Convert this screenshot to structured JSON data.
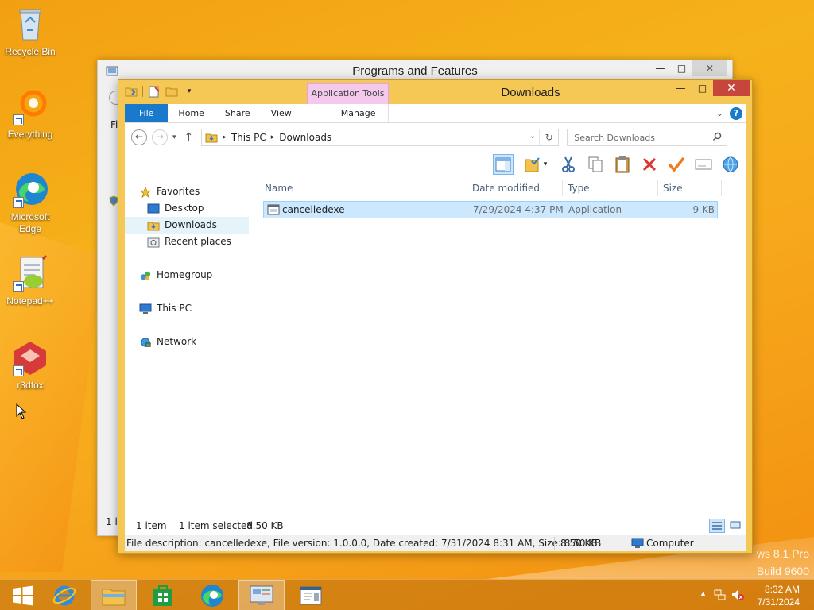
{
  "desktop": {
    "icons": [
      {
        "label": "Recycle Bin"
      },
      {
        "label": "Everything"
      },
      {
        "label": "Microsoft Edge"
      },
      {
        "label": "Notepad++"
      },
      {
        "label": "r3dfox"
      }
    ],
    "watermark_line1": "ws 8.1 Pro",
    "watermark_line2": "Build 9600"
  },
  "back_window": {
    "title": "Programs and Features",
    "partial_label1": "Fi",
    "partial_label2": "1 it",
    "minimize": "—",
    "maximize": "□",
    "close": "✕"
  },
  "explorer": {
    "title": "Downloads",
    "contextual_group": "Application Tools",
    "tabs": {
      "file": "File",
      "home": "Home",
      "share": "Share",
      "view": "View",
      "manage": "Manage"
    },
    "window_controls": {
      "minimize": "—",
      "maximize": "□",
      "close": "✕"
    },
    "address": {
      "crumbs": [
        "This PC",
        "Downloads"
      ]
    },
    "search": {
      "placeholder": "Search Downloads"
    },
    "nav": {
      "favorites": "Favorites",
      "desktop": "Desktop",
      "downloads": "Downloads",
      "recent": "Recent places",
      "homegroup": "Homegroup",
      "thispc": "This PC",
      "network": "Network"
    },
    "columns": {
      "name": "Name",
      "date": "Date modified",
      "type": "Type",
      "size": "Size"
    },
    "files": [
      {
        "name": "cancelledexe",
        "date": "7/29/2024 4:37 PM",
        "type": "Application",
        "size": "9 KB",
        "selected": true
      }
    ],
    "status": {
      "count": "1 item",
      "selected": "1 item selected",
      "selected_size": "8.50 KB"
    },
    "details": {
      "description": "File description: cancelledexe, File version: 1.0.0.0, Date created: 7/31/2024 8:31 AM, Size: 8.50 KB",
      "size": "8.50 KB",
      "location": "Computer"
    }
  },
  "taskbar": {
    "time": "8:32 AM",
    "date": "7/31/2024"
  },
  "colors": {
    "explorer_frame": "#f5c754",
    "file_tab": "#1979ca",
    "app_tools_tab": "#f4c9ed",
    "selection": "#cce8ff",
    "close_button": "#c7463c"
  }
}
